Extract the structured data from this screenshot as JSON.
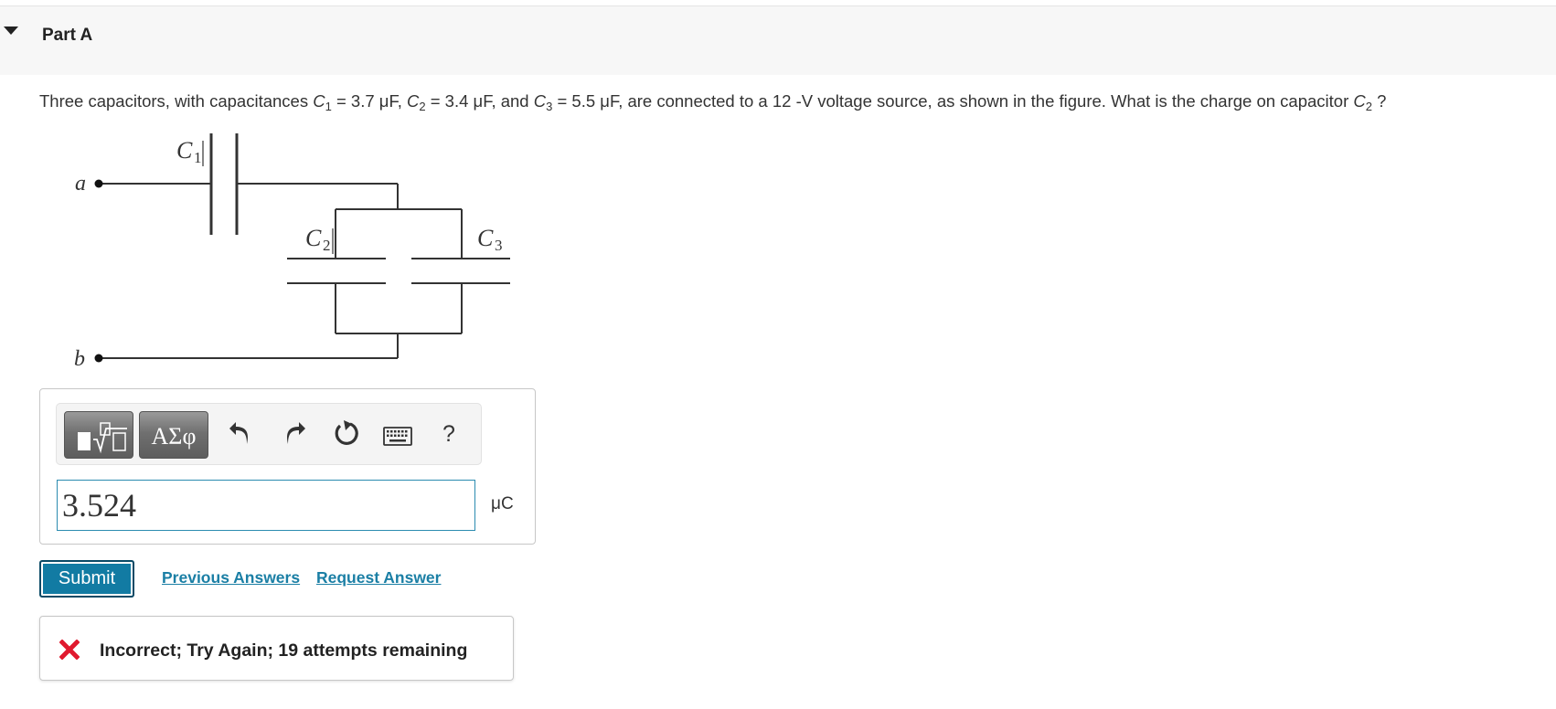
{
  "part": {
    "title": "Part A"
  },
  "question": {
    "intro": "Three capacitors, with capacitances ",
    "c1_letter": "C",
    "c1_sub": "1",
    "c1_value": " = 3.7 μF, ",
    "c2_letter": "C",
    "c2_sub": "2",
    "c2_value": " = 3.4 μF, and ",
    "c3_letter": "C",
    "c3_sub": "3",
    "c3_value": " = 5.5 μF, are connected to a 12 -V voltage source, as shown in the figure. What is the charge on capacitor ",
    "target_letter": "C",
    "target_sub": "2",
    "end": " ?"
  },
  "circuit": {
    "terminal_a": "a",
    "terminal_b": "b",
    "c1_letter": "C",
    "c1_sub": "1",
    "c2_letter": "C",
    "c2_sub": "2",
    "c3_letter": "C",
    "c3_sub": "3"
  },
  "toolbar": {
    "symbols_label": "ΑΣφ",
    "help_label": "?",
    "icons": [
      "templates-icon",
      "greek-symbols-icon",
      "undo-icon",
      "redo-icon",
      "reset-icon",
      "keyboard-icon",
      "help-icon"
    ]
  },
  "answer": {
    "value": "3.524",
    "unit": "μC"
  },
  "actions": {
    "submit_label": "Submit",
    "previous_answers_label": "Previous Answers",
    "request_answer_label": "Request Answer"
  },
  "feedback": {
    "text": "Incorrect; Try Again; 19 attempts remaining",
    "status_color": "#e0192e"
  },
  "colors": {
    "accent": "#127ba3",
    "link": "#1b7fa5",
    "input_border": "#2b8bb0"
  }
}
